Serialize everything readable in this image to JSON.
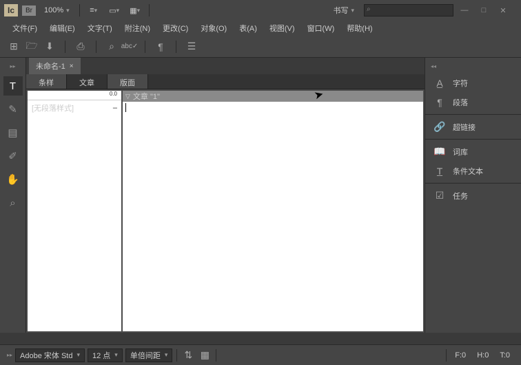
{
  "top": {
    "zoom": "100%",
    "workspace": "书写",
    "search_ph": ""
  },
  "menu": [
    "文件(F)",
    "编辑(E)",
    "文字(T)",
    "附注(N)",
    "更改(C)",
    "对象(O)",
    "表(A)",
    "视图(V)",
    "窗口(W)",
    "帮助(H)"
  ],
  "doc": {
    "tab": "未命名-1",
    "close": "×"
  },
  "ptabs": [
    "条样",
    "文章",
    "版面"
  ],
  "styles": {
    "ruler": "0.0",
    "item": "[无段落样式]",
    "mark": "–"
  },
  "article": {
    "header": "文章 \"1\""
  },
  "right": [
    "字符",
    "段落",
    "超链接",
    "词库",
    "条件文本",
    "任务"
  ],
  "status": {
    "font": "Adobe 宋体 Std",
    "size": "12 点",
    "spacing": "单倍间距",
    "f": "F:0",
    "h": "H:0",
    "t": "T:0"
  }
}
